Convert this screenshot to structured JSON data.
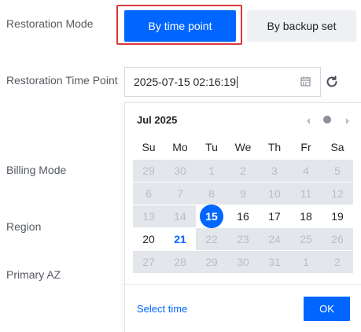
{
  "form": {
    "restoration_mode_label": "Restoration Mode",
    "restoration_time_point_label": "Restoration Time Point",
    "billing_mode_label": "Billing Mode",
    "region_label": "Region",
    "primary_az_label": "Primary AZ"
  },
  "mode_buttons": {
    "by_time_point": "By time point",
    "by_backup_set": "By backup set",
    "selected": "by_time_point"
  },
  "time_input": {
    "value": "2025-07-15 02:16:19",
    "calendar_icon": "calendar-icon",
    "refresh_icon": "refresh-icon"
  },
  "calendar": {
    "month_title": "Jul 2025",
    "weekdays": [
      "Su",
      "Mo",
      "Tu",
      "We",
      "Th",
      "Fr",
      "Sa"
    ],
    "weeks": [
      [
        {
          "d": "29",
          "s": "disabled"
        },
        {
          "d": "30",
          "s": "disabled"
        },
        {
          "d": "1",
          "s": "disabled"
        },
        {
          "d": "2",
          "s": "disabled"
        },
        {
          "d": "3",
          "s": "disabled"
        },
        {
          "d": "4",
          "s": "disabled"
        },
        {
          "d": "5",
          "s": "disabled"
        }
      ],
      [
        {
          "d": "6",
          "s": "disabled"
        },
        {
          "d": "7",
          "s": "disabled"
        },
        {
          "d": "8",
          "s": "disabled"
        },
        {
          "d": "9",
          "s": "disabled"
        },
        {
          "d": "10",
          "s": "disabled"
        },
        {
          "d": "11",
          "s": "disabled"
        },
        {
          "d": "12",
          "s": "disabled"
        }
      ],
      [
        {
          "d": "13",
          "s": "disabled"
        },
        {
          "d": "14",
          "s": "disabled"
        },
        {
          "d": "15",
          "s": "selected"
        },
        {
          "d": "16",
          "s": "normal"
        },
        {
          "d": "17",
          "s": "normal"
        },
        {
          "d": "18",
          "s": "normal"
        },
        {
          "d": "19",
          "s": "normal"
        }
      ],
      [
        {
          "d": "20",
          "s": "normal"
        },
        {
          "d": "21",
          "s": "today"
        },
        {
          "d": "22",
          "s": "disabled"
        },
        {
          "d": "23",
          "s": "disabled"
        },
        {
          "d": "24",
          "s": "disabled"
        },
        {
          "d": "25",
          "s": "disabled"
        },
        {
          "d": "26",
          "s": "disabled"
        }
      ],
      [
        {
          "d": "27",
          "s": "disabled"
        },
        {
          "d": "28",
          "s": "disabled"
        },
        {
          "d": "29",
          "s": "disabled"
        },
        {
          "d": "30",
          "s": "disabled"
        },
        {
          "d": "31",
          "s": "disabled"
        },
        {
          "d": "1",
          "s": "disabled"
        },
        {
          "d": "2",
          "s": "disabled"
        }
      ]
    ],
    "select_time_label": "Select time",
    "ok_label": "OK"
  },
  "colors": {
    "primary": "#0066ff",
    "highlight_outline": "#d9383c",
    "disabled_cell_bg": "#e3e6ea"
  }
}
